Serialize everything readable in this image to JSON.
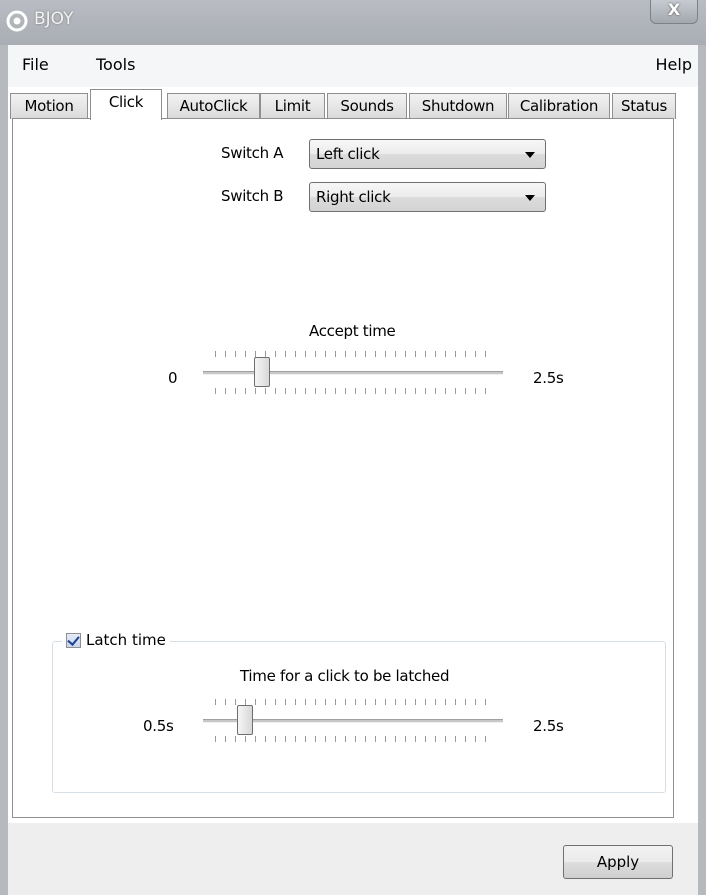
{
  "window": {
    "title": "BJOY",
    "close_label": "X"
  },
  "menu": {
    "file": "File",
    "tools": "Tools",
    "help": "Help"
  },
  "tabs": [
    {
      "label": "Motion",
      "active": false
    },
    {
      "label": "Click",
      "active": true
    },
    {
      "label": "AutoClick",
      "active": false
    },
    {
      "label": "Limit",
      "active": false
    },
    {
      "label": "Sounds",
      "active": false
    },
    {
      "label": "Shutdown",
      "active": false
    },
    {
      "label": "Calibration",
      "active": false
    },
    {
      "label": "Status",
      "active": false
    }
  ],
  "click_tab": {
    "switch_a": {
      "label": "Switch A",
      "value": "Left click"
    },
    "switch_b": {
      "label": "Switch B",
      "value": "Right click"
    },
    "accept_time": {
      "title": "Accept time",
      "min_label": "0",
      "max_label": "2.5s",
      "position": 0.18
    },
    "latch": {
      "checkbox_label": "Latch time",
      "checked": true,
      "title": "Time for a click to be latched",
      "min_label": "0.5s",
      "max_label": "2.5s",
      "position": 0.12
    }
  },
  "footer": {
    "apply_label": "Apply"
  }
}
